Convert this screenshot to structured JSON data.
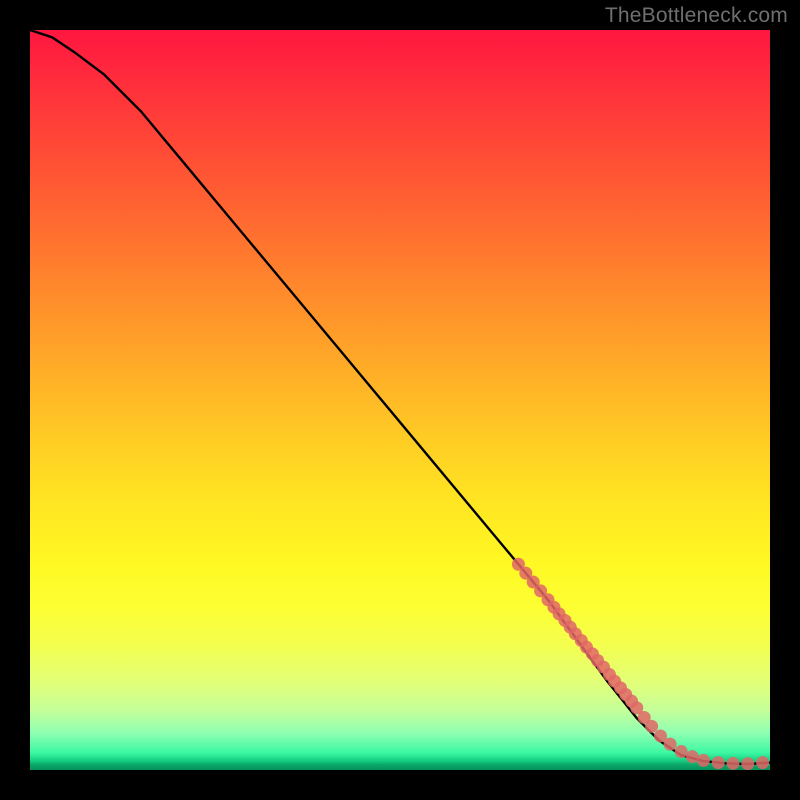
{
  "attribution": "TheBottleneck.com",
  "colors": {
    "background": "#000000",
    "curve": "#000000",
    "marker": "#e06666",
    "attribution_text": "#6f6f6f"
  },
  "chart_data": {
    "type": "line",
    "title": "",
    "xlabel": "",
    "ylabel": "",
    "xlim": [
      0,
      100
    ],
    "ylim": [
      0,
      100
    ],
    "grid": false,
    "legend": null,
    "curve": {
      "x": [
        0,
        3,
        6,
        10,
        15,
        20,
        30,
        40,
        50,
        60,
        70,
        78,
        82,
        85,
        88,
        91,
        94,
        97,
        100
      ],
      "y": [
        100,
        99,
        97,
        94,
        89,
        83,
        71,
        59,
        47,
        35,
        23,
        12,
        7,
        4,
        2,
        1.2,
        0.9,
        0.8,
        1.0
      ]
    },
    "markers": {
      "x": [
        66,
        67,
        68,
        69,
        70,
        70.8,
        71.5,
        72.3,
        73,
        73.7,
        74.5,
        75.2,
        76,
        76.7,
        77.5,
        78.3,
        79,
        79.8,
        80.5,
        81.3,
        82,
        83,
        84,
        85.2,
        86.5,
        88,
        89.5,
        91,
        93,
        95,
        97,
        99
      ],
      "y": [
        27.8,
        26.6,
        25.4,
        24.2,
        23,
        22,
        21.1,
        20.2,
        19.3,
        18.4,
        17.5,
        16.6,
        15.7,
        14.8,
        13.9,
        12.9,
        12.0,
        11.1,
        10.2,
        9.3,
        8.4,
        7.1,
        5.9,
        4.6,
        3.5,
        2.5,
        1.8,
        1.3,
        1.0,
        0.9,
        0.85,
        1.0
      ]
    }
  }
}
